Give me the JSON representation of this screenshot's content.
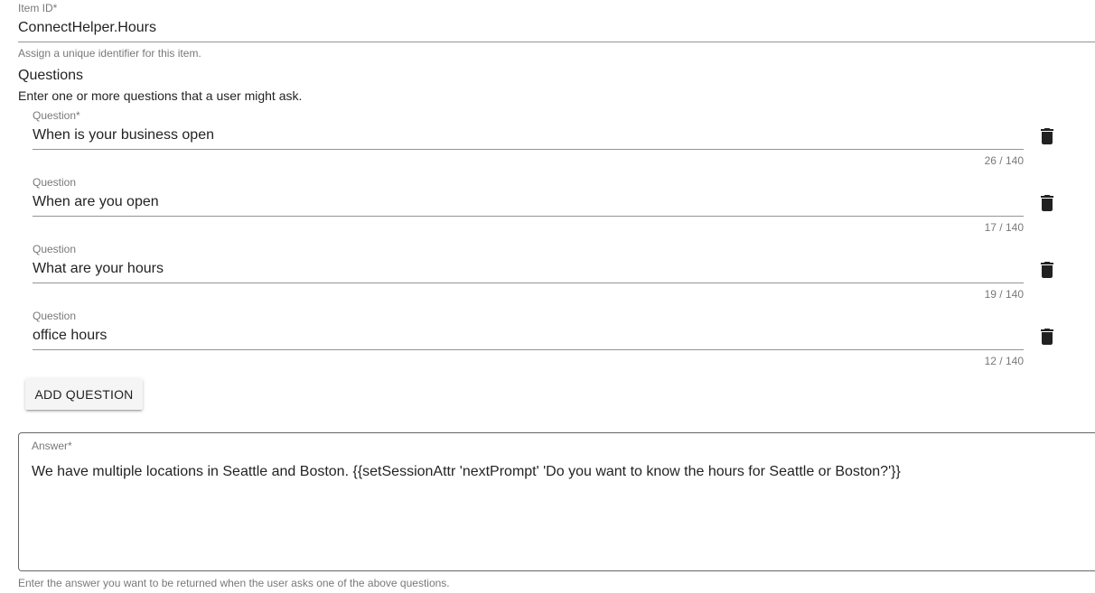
{
  "item_id": {
    "label": "Item ID*",
    "value": "ConnectHelper.Hours",
    "hint": "Assign a unique identifier for this item."
  },
  "questions_section": {
    "title": "Questions",
    "description": "Enter one or more questions that a user might ask.",
    "items": [
      {
        "label": "Question*",
        "value": "When is your business open",
        "counter": "26 / 140"
      },
      {
        "label": "Question",
        "value": "When are you open",
        "counter": "17 / 140"
      },
      {
        "label": "Question",
        "value": "What are your hours",
        "counter": "19 / 140"
      },
      {
        "label": "Question",
        "value": "office hours",
        "counter": "12 / 140"
      }
    ],
    "add_button_label": "ADD QUESTION"
  },
  "answer": {
    "label": "Answer*",
    "value": "We have multiple locations in Seattle and Boston.  {{setSessionAttr 'nextPrompt' 'Do you want to know the hours for Seattle or Boston?'}}",
    "hint": "Enter the answer you want to be returned when the user asks one of the above questions."
  },
  "icons": {
    "delete": "trash-icon"
  },
  "colors": {
    "text": "#212121",
    "secondary_text": "#757575",
    "button_bg": "#f5f5f5",
    "icon": "#212121"
  }
}
